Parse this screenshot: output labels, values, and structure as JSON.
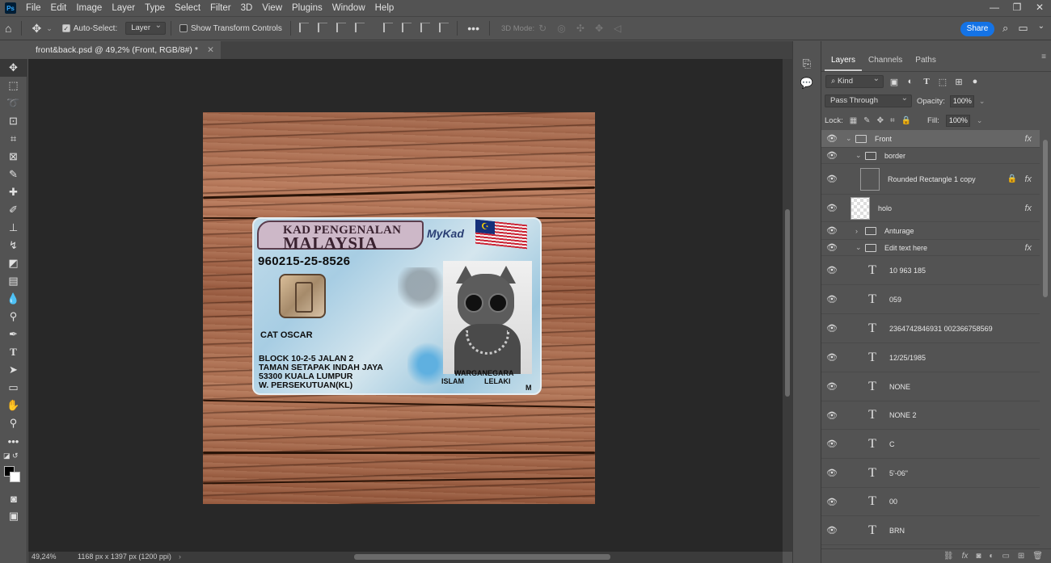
{
  "menubar": {
    "logo": "Ps",
    "items": [
      "File",
      "Edit",
      "Image",
      "Layer",
      "Type",
      "Select",
      "Filter",
      "3D",
      "View",
      "Plugins",
      "Window",
      "Help"
    ],
    "window_controls": [
      "—",
      "❐",
      "✕"
    ]
  },
  "options": {
    "auto_select_label": "Auto-Select:",
    "auto_select_checked": true,
    "auto_select_target": "Layer",
    "show_transform_label": "Show Transform Controls",
    "show_transform_checked": false,
    "more": "•••",
    "mode3d_label": "3D Mode:",
    "share_label": "Share"
  },
  "document": {
    "tab_title": "front&back.psd @ 49,2% (Front, RGB/8#) *",
    "close": "✕",
    "zoom": "49,24%",
    "size_info": "1168 px x 1397 px (1200 ppi)",
    "status_arrow": "›"
  },
  "card": {
    "header_line1": "KAD PENGENALAN",
    "header_line2": "MALAYSIA",
    "brand": "MyKad",
    "flag_symbol": "☪",
    "ic_number": "960215-25-8526",
    "name": "CAT OSCAR",
    "address": [
      "BLOCK 10-2-5 JALAN 2",
      "TAMAN SETAPAK INDAH JAYA",
      "53300 KUALA LUMPUR",
      "W. PERSEKUTUAN(KL)"
    ],
    "citizenship": "WARGANEGARA",
    "religion": "ISLAM",
    "gender": "LELAKI",
    "m": "M"
  },
  "panel": {
    "tabs": [
      "Layers",
      "Channels",
      "Paths"
    ],
    "active_tab": "Layers",
    "filter_kind": "Kind",
    "blend_mode": "Pass Through",
    "opacity_label": "Opacity:",
    "opacity_value": "100%",
    "lock_label": "Lock:",
    "fill_label": "Fill:",
    "fill_value": "100%",
    "layers": [
      {
        "name": "Front",
        "kind": "group",
        "indent": 0,
        "expanded": true,
        "fx": true,
        "selected": true
      },
      {
        "name": "border",
        "kind": "group",
        "indent": 1,
        "expanded": true,
        "fx": false
      },
      {
        "name": "Rounded Rectangle 1 copy",
        "kind": "shape",
        "indent": 1,
        "fx": true,
        "locked": true
      },
      {
        "name": "holo",
        "kind": "pixel",
        "indent": 0,
        "fx": true
      },
      {
        "name": "Anturage",
        "kind": "group",
        "indent": 1,
        "expanded": false,
        "fx": false
      },
      {
        "name": "Edit text here",
        "kind": "group",
        "indent": 1,
        "expanded": true,
        "fx": true
      },
      {
        "name": "10 963 185",
        "kind": "text"
      },
      {
        "name": "059",
        "kind": "text"
      },
      {
        "name": "2364742846931 002366758569",
        "kind": "text"
      },
      {
        "name": "12/25/1985",
        "kind": "text"
      },
      {
        "name": "NONE",
        "kind": "text"
      },
      {
        "name": "NONE 2",
        "kind": "text"
      },
      {
        "name": "C",
        "kind": "text"
      },
      {
        "name": "5'-06\"",
        "kind": "text"
      },
      {
        "name": "00",
        "kind": "text"
      },
      {
        "name": "BRN",
        "kind": "text"
      }
    ]
  }
}
